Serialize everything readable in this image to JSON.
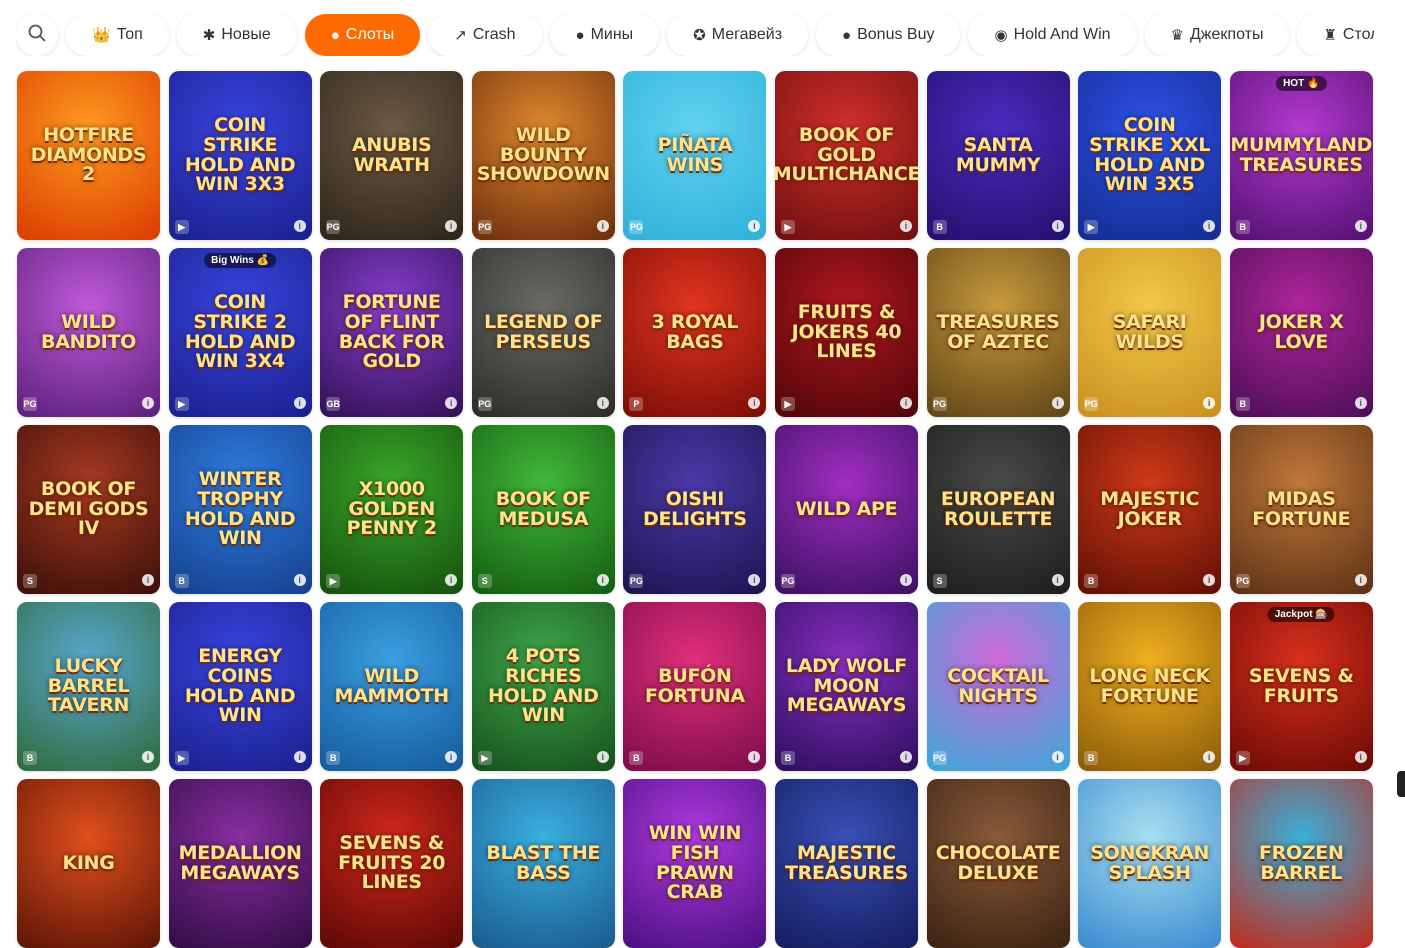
{
  "nav": {
    "search_icon": "search-icon",
    "chips": [
      {
        "icon": "👑",
        "label": "Топ",
        "active": false
      },
      {
        "icon": "✱",
        "label": "Новые",
        "active": false
      },
      {
        "icon": "●",
        "label": "Слоты",
        "active": true
      },
      {
        "icon": "↗",
        "label": "Crash",
        "active": false
      },
      {
        "icon": "●",
        "label": "Мины",
        "active": false
      },
      {
        "icon": "✪",
        "label": "Мегавейз",
        "active": false
      },
      {
        "icon": "●",
        "label": "Bonus Buy",
        "active": false
      },
      {
        "icon": "◉",
        "label": "Hold And Win",
        "active": false
      },
      {
        "icon": "♛",
        "label": "Джекпоты",
        "active": false
      },
      {
        "icon": "♜",
        "label": "Столы",
        "active": false
      }
    ],
    "accent_color": "#ff6a00"
  },
  "games": [
    {
      "title": "Hotfire Diamonds 2",
      "bg": [
        "#ff9a1f",
        "#d93c00"
      ],
      "provider": "",
      "badge": ""
    },
    {
      "title": "Coin Strike Hold and Win 3x3",
      "bg": [
        "#3a45e0",
        "#1a1f8c"
      ],
      "provider": "▶",
      "badge": ""
    },
    {
      "title": "Anubis Wrath",
      "bg": [
        "#6b5a45",
        "#2c2419"
      ],
      "provider": "PG",
      "badge": ""
    },
    {
      "title": "Wild Bounty Showdown",
      "bg": [
        "#e0892c",
        "#6b2d0e"
      ],
      "provider": "PG",
      "badge": ""
    },
    {
      "title": "Piñata Wins",
      "bg": [
        "#5fd3f0",
        "#2fb0d8"
      ],
      "provider": "PG",
      "badge": ""
    },
    {
      "title": "Book of Gold Multichance",
      "bg": [
        "#d2302a",
        "#6d0f0f"
      ],
      "provider": "▶",
      "badge": ""
    },
    {
      "title": "Santa Mummy",
      "bg": [
        "#4a2bc0",
        "#22106b"
      ],
      "provider": "B",
      "badge": ""
    },
    {
      "title": "Coin Strike XXL Hold and Win 3x5",
      "bg": [
        "#2d52e8",
        "#142b8f"
      ],
      "provider": "▶",
      "badge": ""
    },
    {
      "title": "Mummyland Treasures",
      "bg": [
        "#b43ad0",
        "#521070"
      ],
      "provider": "B",
      "badge": "HOT 🔥"
    },
    {
      "title": "Wild Bandito",
      "bg": [
        "#c05ad8",
        "#5a1f7a"
      ],
      "provider": "PG",
      "badge": ""
    },
    {
      "title": "Coin Strike 2 Hold and Win 3x4",
      "bg": [
        "#3a45e0",
        "#1a1f8c"
      ],
      "provider": "▶",
      "badge": "Big Wins 💰"
    },
    {
      "title": "Fortune of Flint Back for Gold",
      "bg": [
        "#8a3ed0",
        "#2f1052"
      ],
      "provider": "GB",
      "badge": ""
    },
    {
      "title": "Legend of Perseus",
      "bg": [
        "#6b6b66",
        "#2a2a27"
      ],
      "provider": "PG",
      "badge": ""
    },
    {
      "title": "3 Royal Bags",
      "bg": [
        "#e2351f",
        "#7a0d06"
      ],
      "provider": "P",
      "badge": ""
    },
    {
      "title": "Fruits & Jokers 40 Lines",
      "bg": [
        "#b0181e",
        "#4d050a"
      ],
      "provider": "▶",
      "badge": ""
    },
    {
      "title": "Treasures of Aztec",
      "bg": [
        "#c79a3c",
        "#5e4315"
      ],
      "provider": "PG",
      "badge": ""
    },
    {
      "title": "Safari Wilds",
      "bg": [
        "#f2c84a",
        "#c8901c"
      ],
      "provider": "PG",
      "badge": ""
    },
    {
      "title": "Joker X Love",
      "bg": [
        "#b0259c",
        "#4a0e55"
      ],
      "provider": "B",
      "badge": ""
    },
    {
      "title": "Book of Demi Gods IV",
      "bg": [
        "#a83a22",
        "#3a0f08"
      ],
      "provider": "S",
      "badge": ""
    },
    {
      "title": "Winter Trophy Hold and Win",
      "bg": [
        "#2f7ee0",
        "#153f8c"
      ],
      "provider": "B",
      "badge": ""
    },
    {
      "title": "x1000 Golden Penny 2",
      "bg": [
        "#3aa82a",
        "#14500c"
      ],
      "provider": "▶",
      "badge": ""
    },
    {
      "title": "Book of Medusa",
      "bg": [
        "#42b83a",
        "#135c10"
      ],
      "provider": "S",
      "badge": ""
    },
    {
      "title": "Oishi Delights",
      "bg": [
        "#4a3aa8",
        "#1c1450"
      ],
      "provider": "PG",
      "badge": ""
    },
    {
      "title": "Wild Ape",
      "bg": [
        "#a02ec0",
        "#3a1060"
      ],
      "provider": "PG",
      "badge": ""
    },
    {
      "title": "European Roulette",
      "bg": [
        "#4a4a48",
        "#1c1c1b"
      ],
      "provider": "S",
      "badge": ""
    },
    {
      "title": "Majestic Joker",
      "bg": [
        "#d03a18",
        "#5e0f04"
      ],
      "provider": "B",
      "badge": ""
    },
    {
      "title": "Midas Fortune",
      "bg": [
        "#c0793a",
        "#5c3015"
      ],
      "provider": "PG",
      "badge": ""
    },
    {
      "title": "Lucky Barrel Tavern",
      "bg": [
        "#58a8d0",
        "#2f6a3a"
      ],
      "provider": "B",
      "badge": ""
    },
    {
      "title": "Energy Coins Hold and Win",
      "bg": [
        "#3a45e0",
        "#1a1f8c"
      ],
      "provider": "▶",
      "badge": ""
    },
    {
      "title": "Wild Mammoth",
      "bg": [
        "#3aa0e0",
        "#145a9c"
      ],
      "provider": "B",
      "badge": ""
    },
    {
      "title": "4 Pots Riches Hold and Win",
      "bg": [
        "#3ea84a",
        "#164f1c"
      ],
      "provider": "▶",
      "badge": ""
    },
    {
      "title": "Bufón Fortuna",
      "bg": [
        "#e2307a",
        "#7a0c48"
      ],
      "provider": "B",
      "badge": ""
    },
    {
      "title": "Lady Wolf Moon Megaways",
      "bg": [
        "#8a2ec0",
        "#2a0f5c"
      ],
      "provider": "B",
      "badge": ""
    },
    {
      "title": "Cocktail Nights",
      "bg": [
        "#d06ad8",
        "#3aa8d8"
      ],
      "provider": "PG",
      "badge": ""
    },
    {
      "title": "Long Neck Fortune",
      "bg": [
        "#f0b020",
        "#8a5a08"
      ],
      "provider": "B",
      "badge": ""
    },
    {
      "title": "Sevens & Fruits",
      "bg": [
        "#d8301c",
        "#6a0a04"
      ],
      "provider": "▶",
      "badge": "Jackpot 🎰"
    },
    {
      "title": "King",
      "bg": [
        "#e0501c",
        "#5c1406"
      ],
      "provider": "",
      "badge": ""
    },
    {
      "title": "Medallion Megaways",
      "bg": [
        "#8a2ea0",
        "#300c45"
      ],
      "provider": "",
      "badge": ""
    },
    {
      "title": "Sevens & Fruits 20 Lines",
      "bg": [
        "#d0281c",
        "#5c0804"
      ],
      "provider": "",
      "badge": ""
    },
    {
      "title": "Blast the Bass",
      "bg": [
        "#3ab0e0",
        "#1a5a8c"
      ],
      "provider": "",
      "badge": ""
    },
    {
      "title": "Win Win Fish Prawn Crab",
      "bg": [
        "#b03ae0",
        "#4a1080"
      ],
      "provider": "",
      "badge": ""
    },
    {
      "title": "Majestic Treasures",
      "bg": [
        "#3a50b8",
        "#141c5c"
      ],
      "provider": "",
      "badge": ""
    },
    {
      "title": "Chocolate Deluxe",
      "bg": [
        "#8a5a3a",
        "#3a2212"
      ],
      "provider": "",
      "badge": ""
    },
    {
      "title": "Songkran Splash",
      "bg": [
        "#a8e0f0",
        "#3a8ad0"
      ],
      "provider": "",
      "badge": ""
    },
    {
      "title": "Frozen Barrel",
      "bg": [
        "#3ab0d8",
        "#c02a1c"
      ],
      "provider": "",
      "badge": ""
    }
  ]
}
